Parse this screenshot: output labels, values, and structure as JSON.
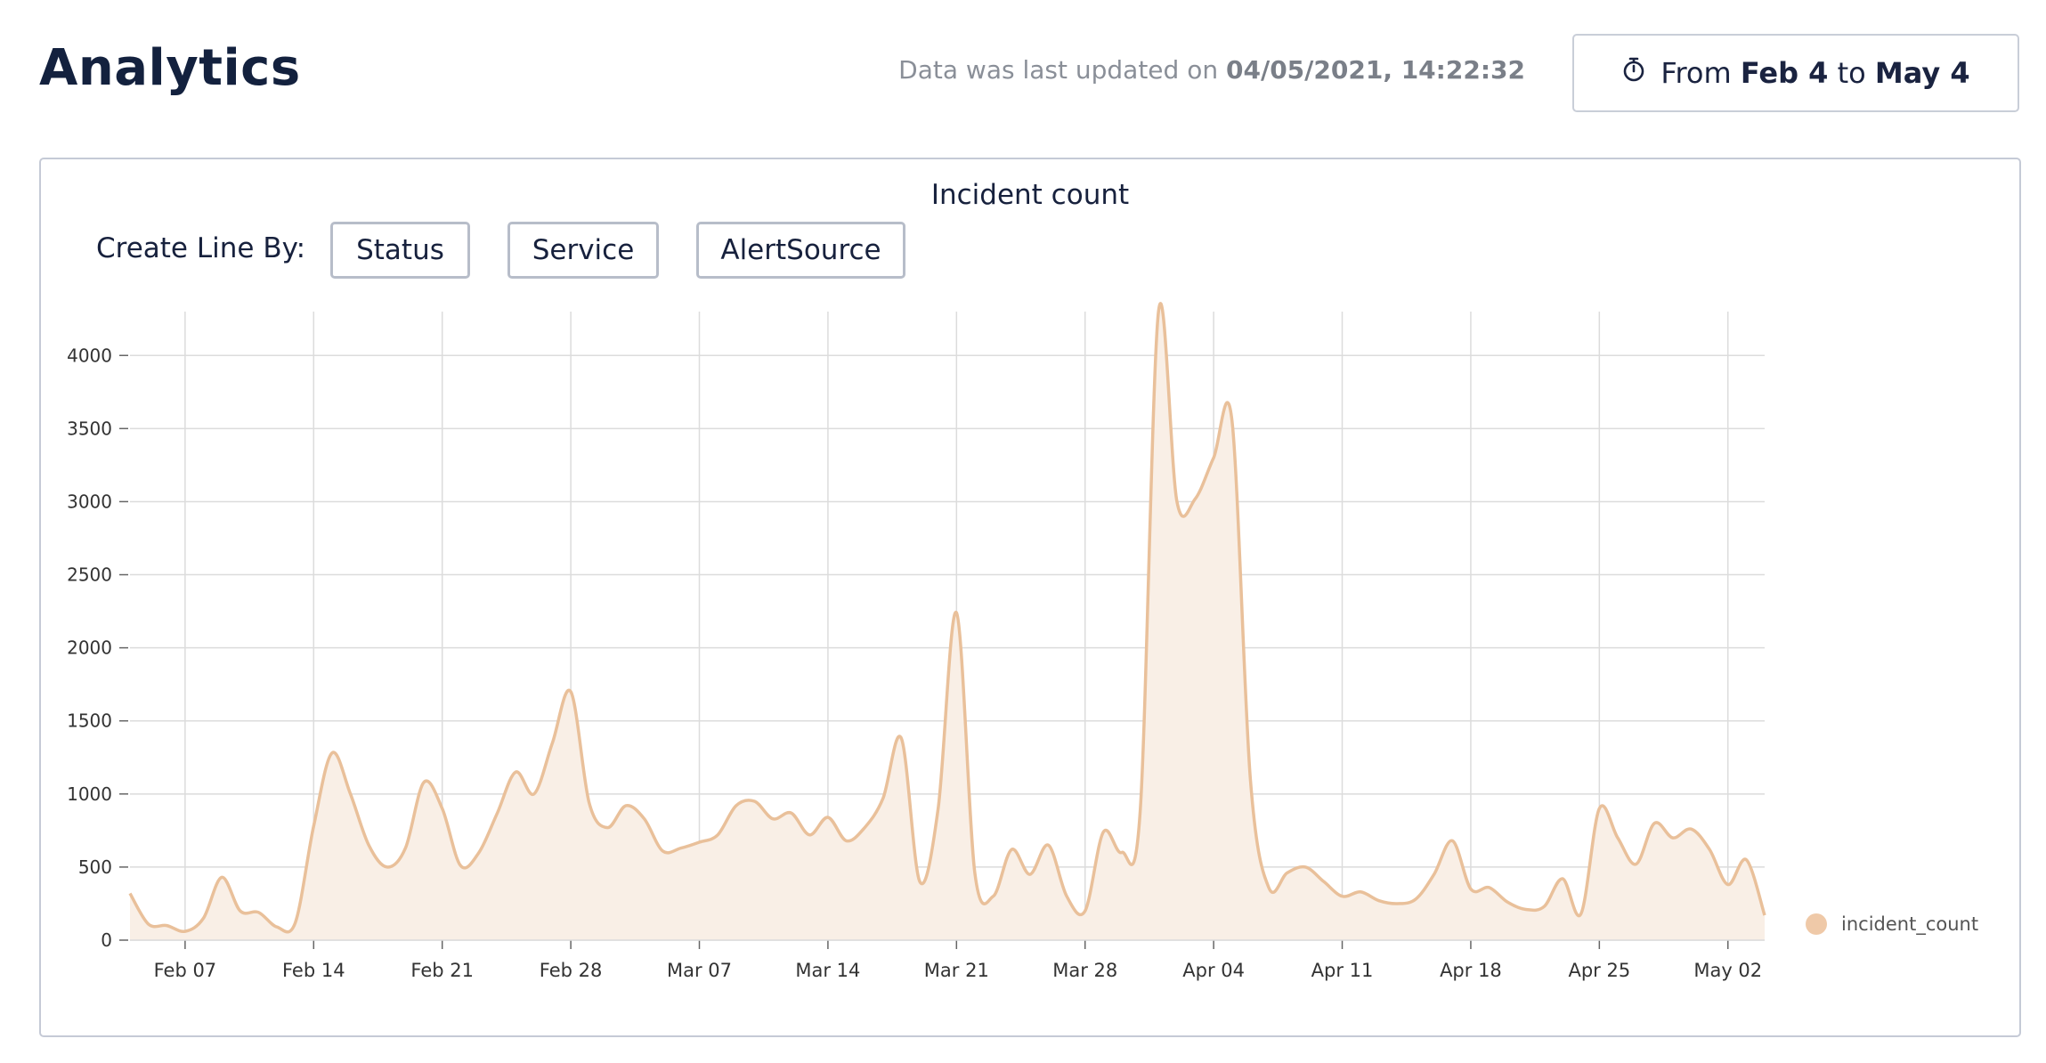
{
  "header": {
    "title": "Analytics",
    "updated_prefix": "Data was last updated on ",
    "updated_value": "04/05/2021, 14:22:32",
    "range": {
      "icon": "stopwatch-icon",
      "prefix": "From ",
      "start": "Feb 4",
      "middle": " to ",
      "end": "May 4"
    }
  },
  "controls": {
    "create_line_label": "Create Line By:",
    "buttons": [
      "Status",
      "Service",
      "AlertSource"
    ]
  },
  "colors": {
    "line": "#e9c09a",
    "fill": "#f9efe6",
    "grid": "#dcdcdc",
    "legend_dot": "#efc9a8"
  },
  "chart_data": {
    "type": "area",
    "title": "Incident count",
    "xlabel": "",
    "ylabel": "",
    "ylim": [
      0,
      4300
    ],
    "y_ticks": [
      0,
      500,
      1000,
      1500,
      2000,
      2500,
      3000,
      3500,
      4000
    ],
    "x_tick_labels": [
      "Feb 07",
      "Feb 14",
      "Feb 21",
      "Feb 28",
      "Mar 07",
      "Mar 14",
      "Mar 21",
      "Mar 28",
      "Apr 04",
      "Apr 11",
      "Apr 18",
      "Apr 25",
      "May 02"
    ],
    "x_start": "2021-02-04",
    "x_end": "2021-05-04",
    "grid": true,
    "legend_position": "right",
    "series": [
      {
        "name": "incident_count",
        "x": [
          "2021-02-04",
          "2021-02-05",
          "2021-02-06",
          "2021-02-07",
          "2021-02-08",
          "2021-02-09",
          "2021-02-10",
          "2021-02-11",
          "2021-02-12",
          "2021-02-13",
          "2021-02-14",
          "2021-02-15",
          "2021-02-16",
          "2021-02-17",
          "2021-02-18",
          "2021-02-19",
          "2021-02-20",
          "2021-02-21",
          "2021-02-22",
          "2021-02-23",
          "2021-02-24",
          "2021-02-25",
          "2021-02-26",
          "2021-02-27",
          "2021-02-28",
          "2021-03-01",
          "2021-03-02",
          "2021-03-03",
          "2021-03-04",
          "2021-03-05",
          "2021-03-06",
          "2021-03-07",
          "2021-03-08",
          "2021-03-09",
          "2021-03-10",
          "2021-03-11",
          "2021-03-12",
          "2021-03-13",
          "2021-03-14",
          "2021-03-15",
          "2021-03-16",
          "2021-03-17",
          "2021-03-18",
          "2021-03-19",
          "2021-03-20",
          "2021-03-21",
          "2021-03-22",
          "2021-03-23",
          "2021-03-24",
          "2021-03-25",
          "2021-03-26",
          "2021-03-27",
          "2021-03-28",
          "2021-03-29",
          "2021-03-30",
          "2021-03-31",
          "2021-04-01",
          "2021-04-02",
          "2021-04-03",
          "2021-04-04",
          "2021-04-05",
          "2021-04-06",
          "2021-04-07",
          "2021-04-08",
          "2021-04-09",
          "2021-04-10",
          "2021-04-11",
          "2021-04-12",
          "2021-04-13",
          "2021-04-14",
          "2021-04-15",
          "2021-04-16",
          "2021-04-17",
          "2021-04-18",
          "2021-04-19",
          "2021-04-20",
          "2021-04-21",
          "2021-04-22",
          "2021-04-23",
          "2021-04-24",
          "2021-04-25",
          "2021-04-26",
          "2021-04-27",
          "2021-04-28",
          "2021-04-29",
          "2021-04-30",
          "2021-05-01",
          "2021-05-02",
          "2021-05-03",
          "2021-05-04"
        ],
        "values": [
          320,
          110,
          100,
          60,
          150,
          430,
          200,
          190,
          90,
          120,
          780,
          1280,
          1000,
          650,
          500,
          630,
          1080,
          900,
          510,
          600,
          870,
          1150,
          1000,
          1350,
          1700,
          940,
          770,
          920,
          830,
          610,
          630,
          670,
          720,
          920,
          950,
          830,
          870,
          720,
          840,
          680,
          770,
          970,
          1380,
          400,
          900,
          2240,
          460,
          300,
          620,
          450,
          650,
          300,
          200,
          740,
          600,
          880,
          4300,
          3000,
          3020,
          3300,
          3550,
          1100,
          360,
          460,
          500,
          400,
          300,
          330,
          270,
          250,
          280,
          450,
          680,
          350,
          360,
          260,
          210,
          230,
          420,
          180,
          900,
          700,
          520,
          800,
          700,
          760,
          620,
          380,
          550,
          170
        ]
      }
    ]
  }
}
